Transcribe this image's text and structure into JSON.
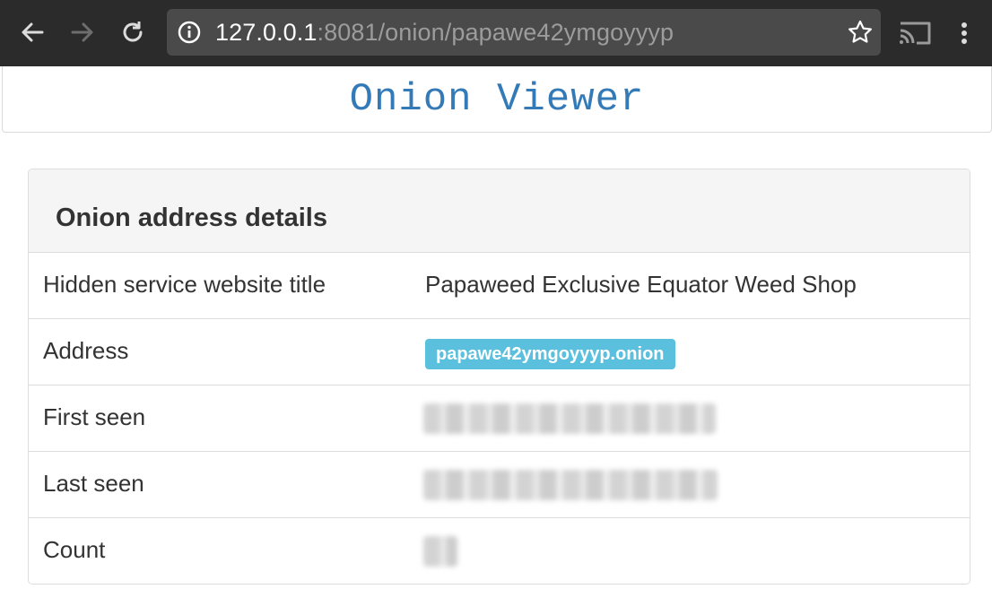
{
  "browser": {
    "url_host": "127.0.0.1",
    "url_rest": ":8081/onion/papawe42ymgoyyyp",
    "icons": [
      "back-icon",
      "forward-icon",
      "reload-icon",
      "info-icon",
      "star-icon",
      "cast-icon",
      "menu-icon"
    ]
  },
  "site": {
    "title": "Onion Viewer",
    "title_color": "#337ab7"
  },
  "panel": {
    "title": "Onion address details",
    "rows": [
      {
        "label": "Hidden service website title",
        "value": "Papaweed Exclusive Equator Weed Shop"
      },
      {
        "label": "Address",
        "value": "papawe42ymgoyyyp.onion"
      },
      {
        "label": "First seen",
        "value": ""
      },
      {
        "label": "Last seen",
        "value": ""
      },
      {
        "label": "Count",
        "value": ""
      }
    ],
    "badge_color": "#5bc0de"
  }
}
